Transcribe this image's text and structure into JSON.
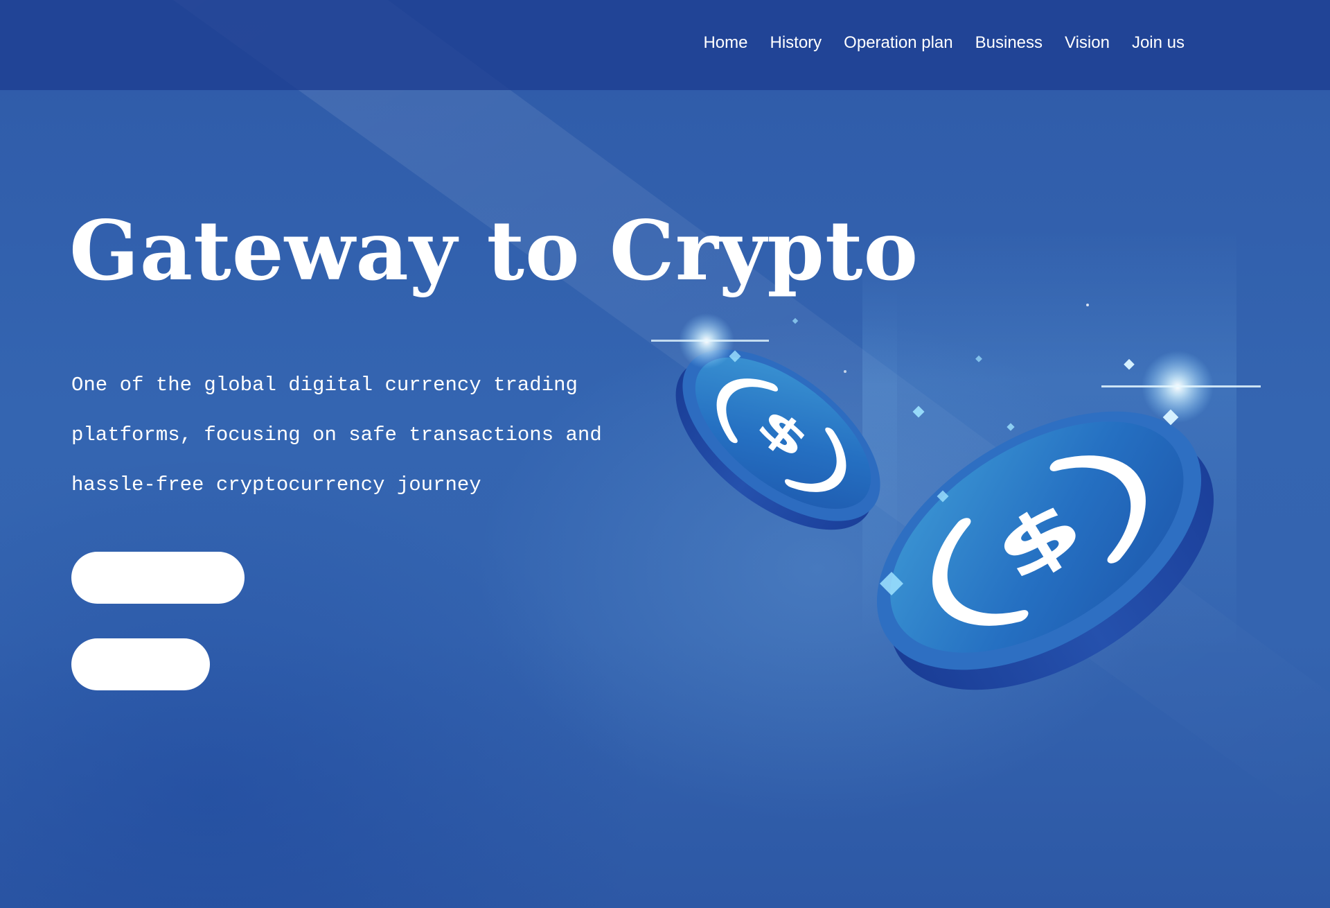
{
  "nav": {
    "items": [
      {
        "label": "Home"
      },
      {
        "label": "History"
      },
      {
        "label": "Operation plan"
      },
      {
        "label": "Business"
      },
      {
        "label": "Vision"
      },
      {
        "label": "Join us"
      }
    ]
  },
  "hero": {
    "title": "Gateway to Crypto",
    "subtitle": "One of the global digital currency trading platforms, focusing on safe transactions and hassle-free cryptocurrency journey",
    "primary_button_label": "",
    "secondary_button_label": ""
  },
  "illustration": {
    "coin_icon": "usd-coin-icon",
    "colors": {
      "background": "#2f5cab",
      "header": "#1e3e91",
      "coin_face": "#2a6fc0",
      "coin_edge": "#1b3f9a",
      "coin_symbol": "#ffffff",
      "sparkle": "#9fe3ff"
    }
  }
}
